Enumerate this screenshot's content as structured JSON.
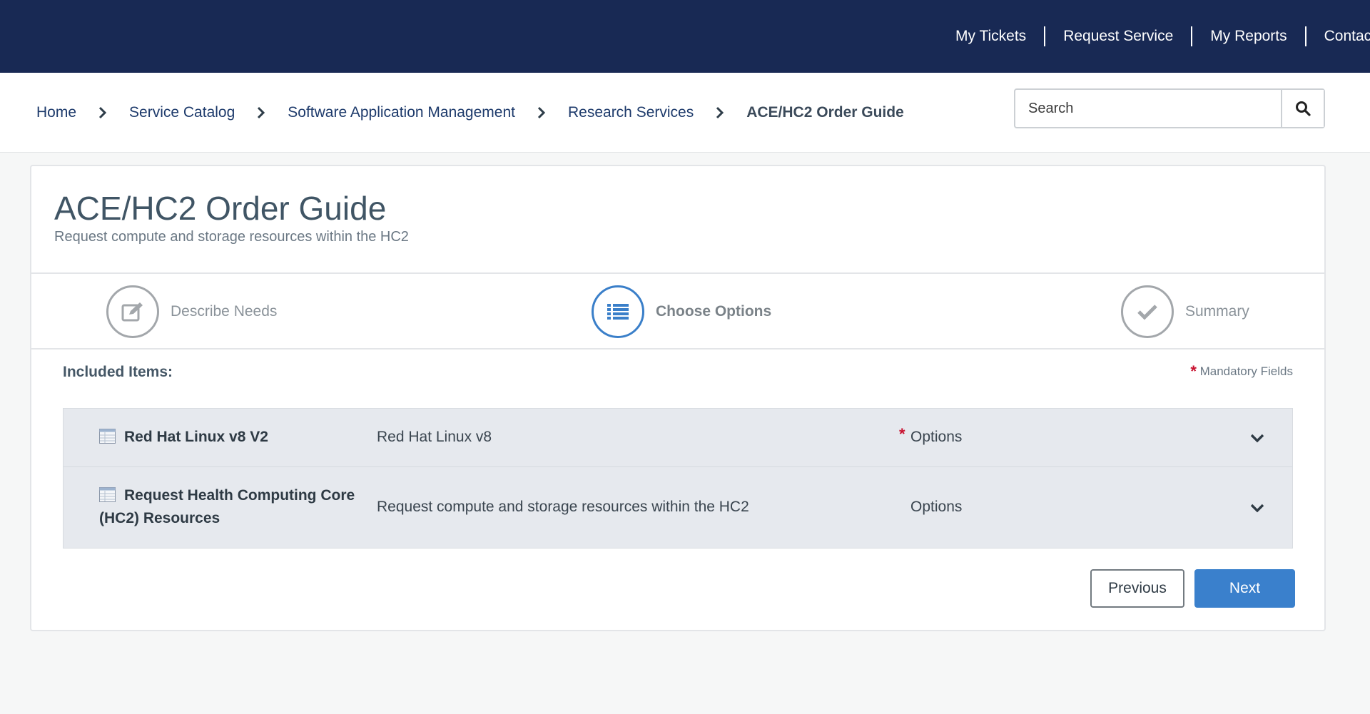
{
  "topnav": {
    "items": [
      {
        "label": "My Tickets"
      },
      {
        "label": "Request Service"
      },
      {
        "label": "My Reports"
      },
      {
        "label": "Contact U"
      }
    ]
  },
  "breadcrumb": {
    "items": [
      {
        "label": "Home"
      },
      {
        "label": "Service Catalog"
      },
      {
        "label": "Software Application Management"
      },
      {
        "label": "Research Services"
      },
      {
        "label": "ACE/HC2 Order Guide"
      }
    ]
  },
  "search": {
    "placeholder": "Search",
    "icon": "search-icon"
  },
  "page": {
    "title": "ACE/HC2 Order Guide",
    "subtitle": "Request compute and storage resources within the HC2"
  },
  "steps": [
    {
      "label": "Describe Needs",
      "icon": "edit-icon",
      "active": false
    },
    {
      "label": "Choose Options",
      "icon": "list-icon",
      "active": true
    },
    {
      "label": "Summary",
      "icon": "check-icon",
      "active": false
    }
  ],
  "included_items": {
    "label": "Included Items:",
    "mandatory_label": "Mandatory Fields",
    "mandatory_star": "*",
    "rows": [
      {
        "name": "Red Hat Linux v8 V2",
        "description": "Red Hat Linux v8",
        "options_label": "Options",
        "required": true
      },
      {
        "name": "Request Health Computing Core (HC2) Resources",
        "description": "Request compute and storage resources within the HC2",
        "options_label": "Options",
        "required": false
      }
    ]
  },
  "buttons": {
    "previous": "Previous",
    "next": "Next"
  },
  "colors": {
    "nav_bg": "#182954",
    "accent": "#3a80cc",
    "required_star": "#c8102e",
    "row_bg": "#e6e9ee"
  }
}
